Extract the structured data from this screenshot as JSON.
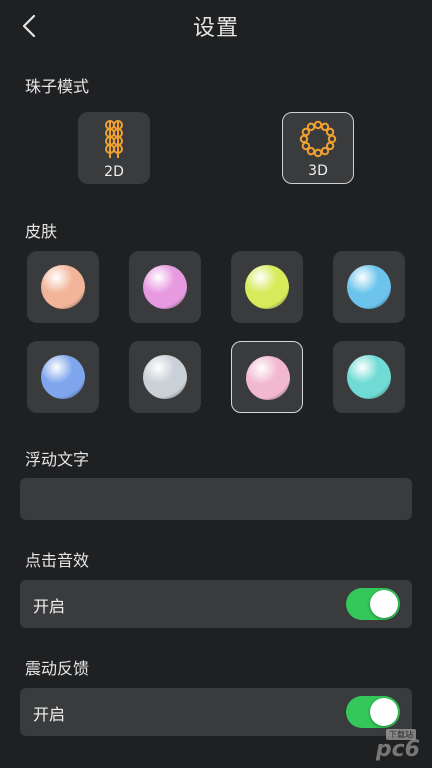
{
  "header": {
    "title": "设置",
    "back_icon": "chevron-left-icon"
  },
  "sections": {
    "bead_mode": "珠子模式",
    "skin": "皮肤",
    "floating_text": "浮动文字",
    "click_sound": "点击音效",
    "vibration": "震动反馈"
  },
  "modes": [
    {
      "label": "2D",
      "icon": "bead-string-icon",
      "selected": false
    },
    {
      "label": "3D",
      "icon": "bead-ring-icon",
      "selected": true
    }
  ],
  "skins": [
    {
      "name": "peach",
      "color": "#f3b59a",
      "selected": false
    },
    {
      "name": "pink",
      "color": "#e89ae0",
      "selected": false
    },
    {
      "name": "lime",
      "color": "#d6ea5a",
      "selected": false
    },
    {
      "name": "sky-blue",
      "color": "#6cc4ec",
      "selected": false
    },
    {
      "name": "periwinkle",
      "color": "#7fa6ec",
      "selected": false
    },
    {
      "name": "silver",
      "color": "#c9d0d6",
      "selected": false
    },
    {
      "name": "light-pink",
      "color": "#f2b8cf",
      "selected": true
    },
    {
      "name": "mint",
      "color": "#6fdbd4",
      "selected": false
    }
  ],
  "floating_text_field": {
    "value": "",
    "placeholder": ""
  },
  "click_sound_row": {
    "label": "开启",
    "enabled": true
  },
  "vibration_row": {
    "label": "开启",
    "enabled": true
  },
  "colors": {
    "accent": "#34c759",
    "background": "#1f2022",
    "card": "#3a3b3d",
    "bead_orange": "#f0a030"
  },
  "watermark": {
    "text": "pc6",
    "badge": "下载站"
  }
}
